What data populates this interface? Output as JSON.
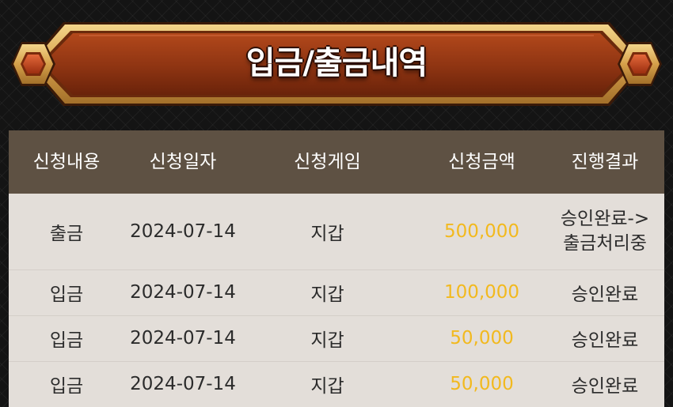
{
  "page": {
    "title": "입금/출금내역"
  },
  "table": {
    "headers": [
      "신청내용",
      "신청일자",
      "신청게임",
      "신청금액",
      "진행결과"
    ],
    "rows": [
      {
        "type": "출금",
        "date": "2024-07-14",
        "game": "지갑",
        "amount": "500,000",
        "status_line1": "승인완료->",
        "status_line2": "출금처리중"
      },
      {
        "type": "입금",
        "date": "2024-07-14",
        "game": "지갑",
        "amount": "100,000",
        "status_line1": "승인완료",
        "status_line2": ""
      },
      {
        "type": "입금",
        "date": "2024-07-14",
        "game": "지갑",
        "amount": "50,000",
        "status_line1": "승인완료",
        "status_line2": ""
      },
      {
        "type": "입금",
        "date": "2024-07-14",
        "game": "지갑",
        "amount": "50,000",
        "status_line1": "승인완료",
        "status_line2": ""
      }
    ]
  },
  "colors": {
    "header_bg": "#5e5143",
    "body_bg": "#e3ded9",
    "amount": "#f2b91e",
    "banner_fill": "#8e3412",
    "banner_border": "#e2b25c"
  },
  "icons": {
    "banner_left": "gold-hexagon-gem-icon",
    "banner_right": "gold-hexagon-gem-icon"
  }
}
